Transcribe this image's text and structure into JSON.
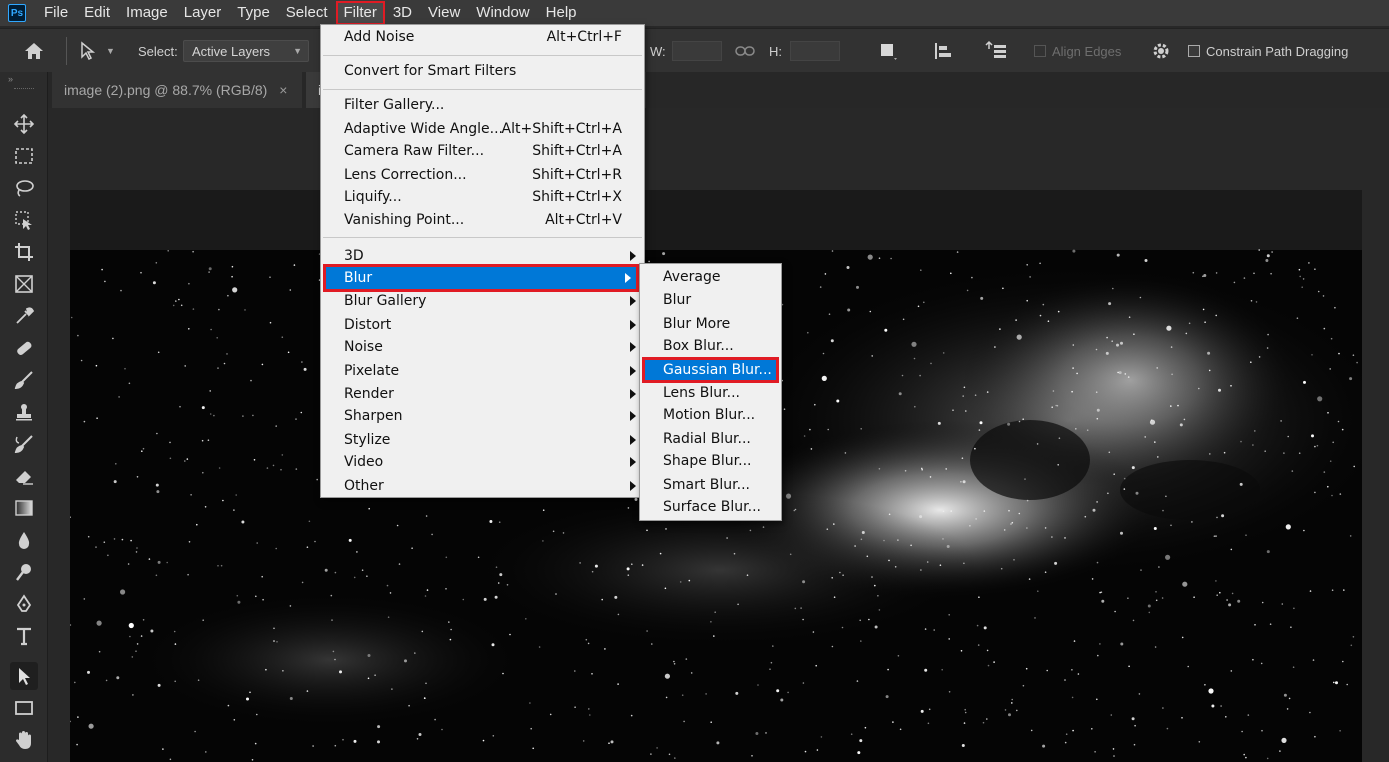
{
  "app": {
    "logo_text": "Ps"
  },
  "menubar": {
    "items": [
      "File",
      "Edit",
      "Image",
      "Layer",
      "Type",
      "Select",
      "Filter",
      "3D",
      "View",
      "Window",
      "Help"
    ],
    "active": "Filter"
  },
  "options_bar": {
    "select_label": "Select:",
    "select_value": "Active Layers",
    "w_label": "W:",
    "h_label": "H:",
    "align_edges": "Align Edges",
    "constrain_path": "Constrain Path Dragging"
  },
  "tabs": [
    {
      "label": "image (2).png @ 88.7% (RGB/8)",
      "close": "×"
    },
    {
      "label": "i"
    }
  ],
  "toolbar": {
    "tools": [
      "move-icon",
      "marquee-icon",
      "lasso-icon",
      "object-select-icon",
      "crop-icon",
      "frame-icon",
      "eyedropper-icon",
      "healing-brush-icon",
      "brush-icon",
      "stamp-icon",
      "history-brush-icon",
      "eraser-icon",
      "gradient-icon",
      "blur-icon",
      "dodge-icon",
      "pen-icon",
      "type-icon",
      "path-select-icon",
      "rectangle-icon",
      "hand-icon"
    ],
    "active_tool": "path-select-icon"
  },
  "filter_menu": {
    "items": [
      {
        "label": "Add Noise",
        "shortcut": "Alt+Ctrl+F"
      },
      {
        "label": "Convert for Smart Filters"
      },
      {
        "label": "Filter Gallery..."
      },
      {
        "label": "Adaptive Wide Angle...",
        "shortcut": "Alt+Shift+Ctrl+A"
      },
      {
        "label": "Camera Raw Filter...",
        "shortcut": "Shift+Ctrl+A"
      },
      {
        "label": "Lens Correction...",
        "shortcut": "Shift+Ctrl+R"
      },
      {
        "label": "Liquify...",
        "shortcut": "Shift+Ctrl+X"
      },
      {
        "label": "Vanishing Point...",
        "shortcut": "Alt+Ctrl+V"
      },
      {
        "label": "3D"
      },
      {
        "label": "Blur"
      },
      {
        "label": "Blur Gallery"
      },
      {
        "label": "Distort"
      },
      {
        "label": "Noise"
      },
      {
        "label": "Pixelate"
      },
      {
        "label": "Render"
      },
      {
        "label": "Sharpen"
      },
      {
        "label": "Stylize"
      },
      {
        "label": "Video"
      },
      {
        "label": "Other"
      }
    ],
    "selected": "Blur"
  },
  "blur_submenu": {
    "items": [
      "Average",
      "Blur",
      "Blur More",
      "Box Blur...",
      "Gaussian Blur...",
      "Lens Blur...",
      "Motion Blur...",
      "Radial Blur...",
      "Shape Blur...",
      "Smart Blur...",
      "Surface Blur..."
    ],
    "selected": "Gaussian Blur..."
  },
  "colors": {
    "highlight_box": "#e01b24",
    "menu_selection": "#0078d7",
    "menu_background": "#f0f0f0"
  }
}
